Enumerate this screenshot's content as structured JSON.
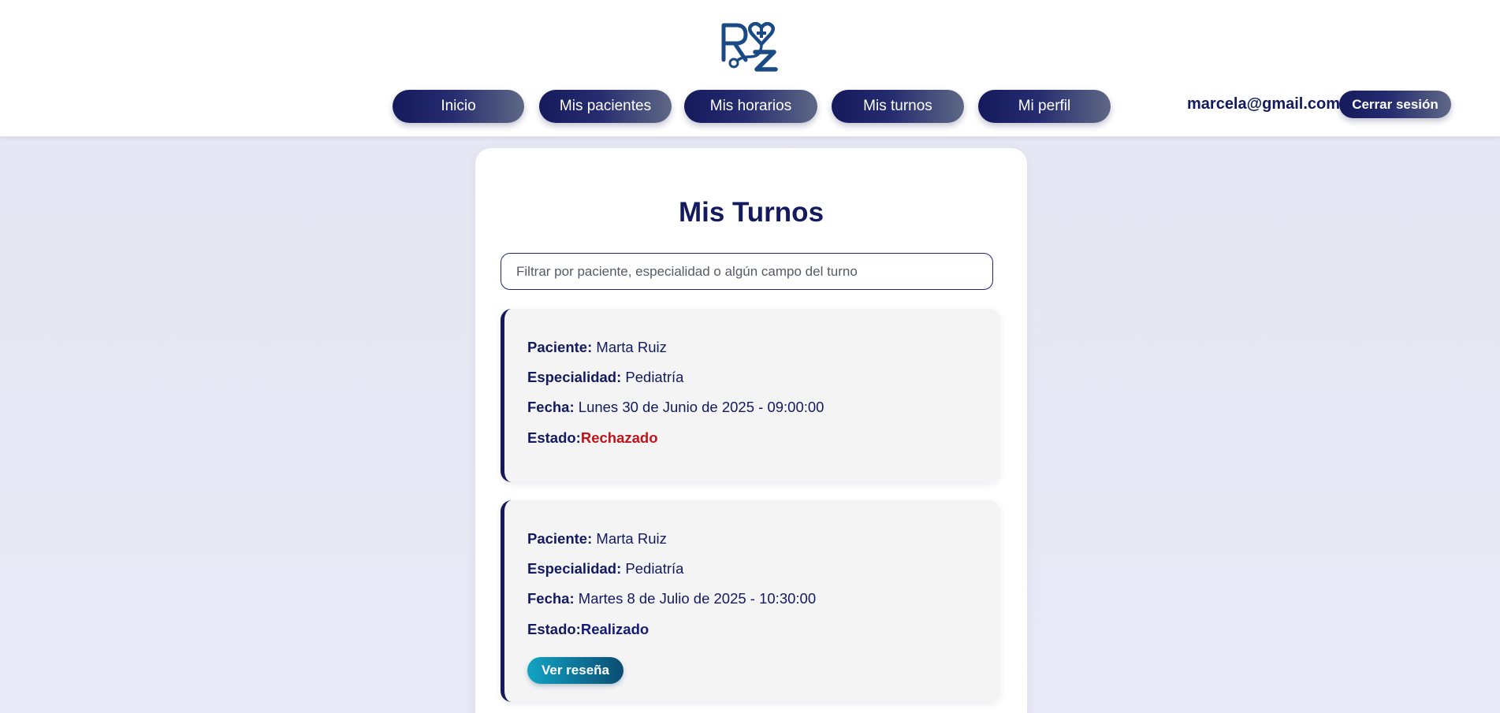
{
  "header": {
    "logo_text": "RZ",
    "nav": [
      {
        "label": "Inicio"
      },
      {
        "label": "Mis pacientes"
      },
      {
        "label": "Mis horarios"
      },
      {
        "label": "Mis turnos"
      },
      {
        "label": "Mi perfil"
      }
    ],
    "user_email": "marcela@gmail.com",
    "logout_label": "Cerrar sesión"
  },
  "main": {
    "title": "Mis Turnos",
    "filter": {
      "placeholder": "Filtrar por paciente, especialidad o algún campo del turno",
      "value": ""
    },
    "labels": {
      "paciente": "Paciente:",
      "especialidad": "Especialidad:",
      "fecha": "Fecha:",
      "estado": "Estado:"
    },
    "turnos": [
      {
        "paciente": "Marta Ruiz",
        "especialidad": "Pediatría",
        "fecha": "Lunes 30 de Junio de 2025 - 09:00:00",
        "estado": "Rechazado"
      },
      {
        "paciente": "Marta Ruiz",
        "especialidad": "Pediatría",
        "fecha": "Martes 8 de Julio de 2025 - 10:30:00",
        "estado": "Realizado",
        "action_label": "Ver reseña"
      }
    ]
  },
  "colors": {
    "primary": "#141a5c",
    "rejected": "#c0141b",
    "done": "#14197a",
    "accent": "#12a4c4"
  }
}
